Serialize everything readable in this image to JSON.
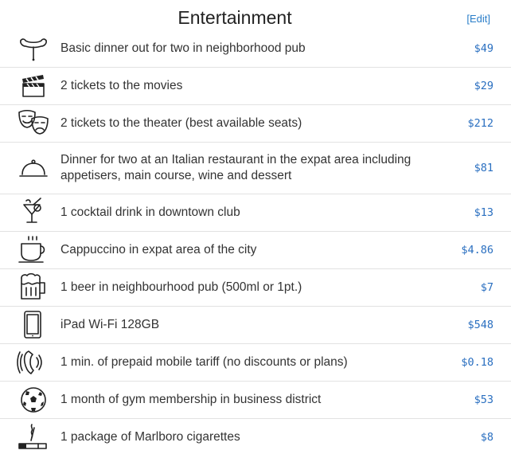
{
  "header": {
    "title": "Entertainment",
    "edit_label": "[Edit]"
  },
  "items": [
    {
      "icon": "sausage-icon",
      "label": "Basic dinner out for two in neighborhood pub",
      "price": "$49"
    },
    {
      "icon": "clapperboard-icon",
      "label": "2 tickets to the movies",
      "price": "$29"
    },
    {
      "icon": "theater-masks-icon",
      "label": "2 tickets to the theater (best available seats)",
      "price": "$212"
    },
    {
      "icon": "cloche-icon",
      "label": "Dinner for two at an Italian restaurant in the expat area including appetisers, main course, wine and dessert",
      "price": "$81"
    },
    {
      "icon": "cocktail-icon",
      "label": "1 cocktail drink in downtown club",
      "price": "$13"
    },
    {
      "icon": "coffee-cup-icon",
      "label": "Cappuccino in expat area of the city",
      "price": "$4.86"
    },
    {
      "icon": "beer-mug-icon",
      "label": "1 beer in neighbourhood pub (500ml or 1pt.)",
      "price": "$7"
    },
    {
      "icon": "tablet-icon",
      "label": "iPad Wi-Fi 128GB",
      "price": "$548"
    },
    {
      "icon": "phone-icon",
      "label": "1 min. of prepaid mobile tariff (no discounts or plans)",
      "price": "$0.18"
    },
    {
      "icon": "soccer-ball-icon",
      "label": "1 month of gym membership in business district",
      "price": "$53"
    },
    {
      "icon": "cigarette-icon",
      "label": "1 package of Marlboro cigarettes",
      "price": "$8"
    }
  ],
  "colors": {
    "link": "#2a7ec9",
    "price": "#2a6fc0",
    "divider": "#e2e2e2"
  }
}
